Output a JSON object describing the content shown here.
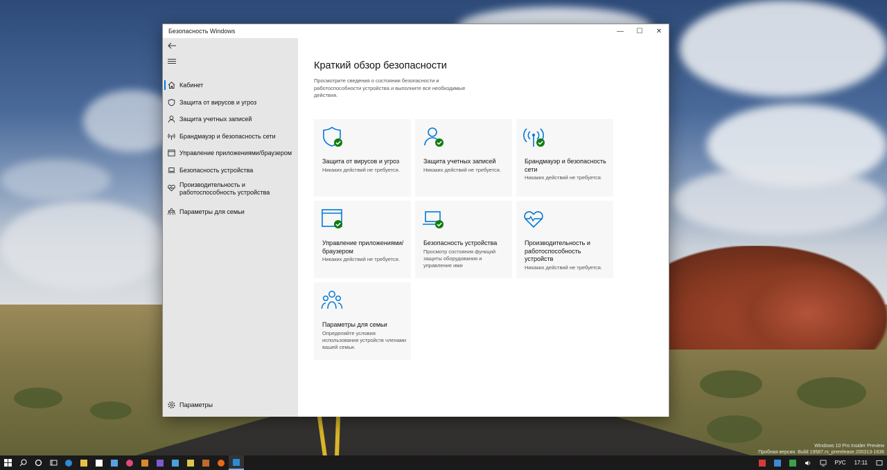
{
  "window": {
    "title": "Безопасность Windows",
    "controls": {
      "minimize": "—",
      "maximize": "☐",
      "close": "✕"
    }
  },
  "sidebar": {
    "items": [
      {
        "label": "Кабинет",
        "icon": "home-icon",
        "active": true
      },
      {
        "label": "Защита от вирусов и угроз",
        "icon": "shield-icon"
      },
      {
        "label": "Защита учетных записей",
        "icon": "person-icon"
      },
      {
        "label": "Брандмауэр и безопасность сети",
        "icon": "wifi-antenna-icon"
      },
      {
        "label": "Управление приложениями/браузером",
        "icon": "app-browser-icon"
      },
      {
        "label": "Безопасность устройства",
        "icon": "laptop-icon"
      },
      {
        "label": "Производительность и работоспособность устройства",
        "icon": "heart-pulse-icon"
      },
      {
        "label": "Параметры для семьи",
        "icon": "family-icon"
      }
    ],
    "settings_label": "Параметры"
  },
  "main": {
    "title": "Краткий обзор безопасности",
    "subtitle": "Просмотрите сведения о состоянии безопасности и работоспособности устройства и выполните все необходимые действия.",
    "cards": [
      {
        "title": "Защита от вирусов и угроз",
        "desc": "Никаких действий не требуется.",
        "icon": "shield-icon",
        "status": "ok"
      },
      {
        "title": "Защита учетных записей",
        "desc": "Никаких действий не требуется.",
        "icon": "person-icon",
        "status": "ok"
      },
      {
        "title": "Брандмауэр и безопасность сети",
        "desc": "Никаких действий не требуется.",
        "icon": "wifi-antenna-icon",
        "status": "ok"
      },
      {
        "title": "Управление приложениями/браузером",
        "desc": "Никаких действий не требуется.",
        "icon": "app-browser-icon",
        "status": "ok"
      },
      {
        "title": "Безопасность устройства",
        "desc": "Просмотр состояния функций защиты оборудования и управление ими",
        "icon": "laptop-icon",
        "status": "ok"
      },
      {
        "title": "Производительность и работоспособность устройств",
        "desc": "Никаких действий не требуется.",
        "icon": "heart-pulse-icon",
        "status": "none"
      },
      {
        "title": "Параметры для семьи",
        "desc": "Определяйте условия использования устройств членами вашей семьи.",
        "icon": "family-icon",
        "status": "none"
      }
    ]
  },
  "taskbar": {
    "language": "РУС",
    "time": "17:11"
  },
  "watermark": {
    "line1": "Windows 10 Pro Insider Preview",
    "line2": "Пробная версия. Build 19587.rs_prerelease.200313-1636"
  },
  "colors": {
    "accent": "#0078d7",
    "ok": "#107c10",
    "sidebar_bg": "#e6e6e6"
  }
}
